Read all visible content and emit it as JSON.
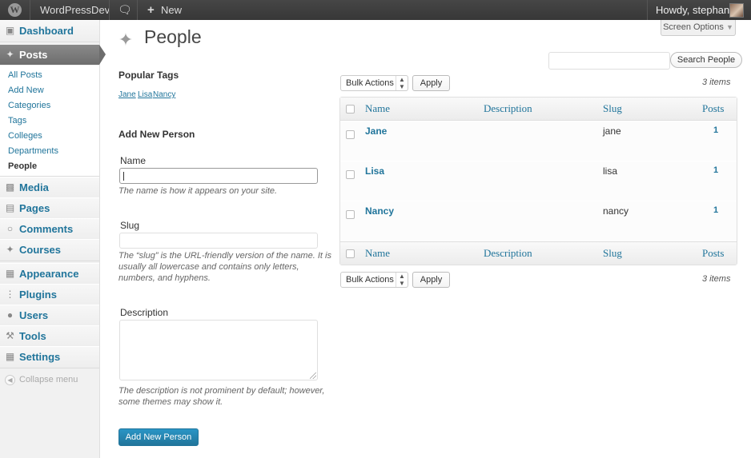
{
  "adminbar": {
    "site_name": "WordPressDev",
    "new_label": "New",
    "howdy": "Howdy, stephanie"
  },
  "sidebar": {
    "items": [
      {
        "label": "Dashboard",
        "icon": "dashboard-icon"
      },
      {
        "label": "Posts",
        "icon": "pushpin-icon",
        "current": true
      },
      {
        "label": "Media",
        "icon": "media-icon"
      },
      {
        "label": "Pages",
        "icon": "pages-icon"
      },
      {
        "label": "Comments",
        "icon": "comments-icon"
      },
      {
        "label": "Courses",
        "icon": "courses-icon"
      },
      {
        "label": "Appearance",
        "icon": "appearance-icon"
      },
      {
        "label": "Plugins",
        "icon": "plugins-icon"
      },
      {
        "label": "Users",
        "icon": "users-icon"
      },
      {
        "label": "Tools",
        "icon": "tools-icon"
      },
      {
        "label": "Settings",
        "icon": "settings-icon"
      }
    ],
    "posts_submenu": [
      "All Posts",
      "Add New",
      "Categories",
      "Tags",
      "Colleges",
      "Departments",
      "People"
    ],
    "current_submenu": "People",
    "collapse_label": "Collapse menu"
  },
  "header": {
    "title": "People",
    "screen_options": "Screen Options"
  },
  "search": {
    "placeholder": "",
    "button_label": "Search People"
  },
  "popular_tags": {
    "title": "Popular Tags",
    "tags": [
      "Jane",
      "Lisa",
      "Nancy"
    ]
  },
  "form": {
    "title": "Add New Person",
    "name_label": "Name",
    "name_value": "",
    "name_hint": "The name is how it appears on your site.",
    "slug_label": "Slug",
    "slug_value": "",
    "slug_hint_1": "The “slug” is the URL-friendly version of the name. It is",
    "slug_hint_2": "usually all lowercase and contains only letters,",
    "slug_hint_3": "numbers, and hyphens.",
    "description_label": "Description",
    "description_value": "",
    "description_hint_1": "The description is not prominent by default; however,",
    "description_hint_2": "some themes may show it.",
    "submit_label": "Add New Person"
  },
  "bulk": {
    "select_value": "Bulk Actions",
    "apply_label": "Apply",
    "items_count": "3 items"
  },
  "table": {
    "columns": [
      "Name",
      "Description",
      "Slug",
      "Posts"
    ],
    "rows": [
      {
        "name": "Jane",
        "description": "",
        "slug": "jane",
        "posts": "1"
      },
      {
        "name": "Lisa",
        "description": "",
        "slug": "lisa",
        "posts": "1"
      },
      {
        "name": "Nancy",
        "description": "",
        "slug": "nancy",
        "posts": "1"
      }
    ]
  },
  "colors": {
    "link": "#21759b",
    "adminbar": "#464646",
    "primary_button": "#21759b"
  }
}
